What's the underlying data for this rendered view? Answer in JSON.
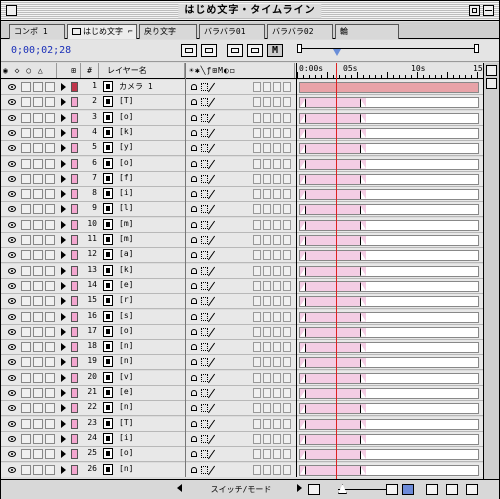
{
  "window": {
    "title": "はじめ文字・タイムライン"
  },
  "tabs": [
    {
      "label": "コンポ 1"
    },
    {
      "label": "はじめ文字 ⌐"
    },
    {
      "label": "戻り文字"
    },
    {
      "label": "バラバラ01"
    },
    {
      "label": "バラバラ02"
    },
    {
      "label": "輪"
    }
  ],
  "toolbar": {
    "timecode": "0;00;02;28",
    "m_label": "M"
  },
  "columns": {
    "switches_icons": "☀✱╲ƒ⊞M◐◻",
    "layer_name": "レイヤー名",
    "num": "#",
    "av": "◉ ◇ ○ △"
  },
  "timeline": {
    "tick_labels": [
      "0:00s",
      "05s",
      "10s",
      "15"
    ]
  },
  "layers": [
    {
      "num": "1",
      "name": "カメラ 1",
      "label_color": "#c0354b",
      "camera": true
    },
    {
      "num": "2",
      "name": "[T]",
      "label_color": "#f3a6cf"
    },
    {
      "num": "3",
      "name": "[o]",
      "label_color": "#f3a6cf"
    },
    {
      "num": "4",
      "name": "[k]",
      "label_color": "#f3a6cf"
    },
    {
      "num": "5",
      "name": "[y]",
      "label_color": "#f3a6cf"
    },
    {
      "num": "6",
      "name": "[o]",
      "label_color": "#f3a6cf"
    },
    {
      "num": "7",
      "name": "[f]",
      "label_color": "#f3a6cf"
    },
    {
      "num": "8",
      "name": "[i]",
      "label_color": "#f3a6cf"
    },
    {
      "num": "9",
      "name": "[l]",
      "label_color": "#f3a6cf"
    },
    {
      "num": "10",
      "name": "[m]",
      "label_color": "#f3a6cf"
    },
    {
      "num": "11",
      "name": "[m]",
      "label_color": "#f3a6cf"
    },
    {
      "num": "12",
      "name": "[a]",
      "label_color": "#f3a6cf"
    },
    {
      "num": "13",
      "name": "[k]",
      "label_color": "#f3a6cf"
    },
    {
      "num": "14",
      "name": "[e]",
      "label_color": "#f3a6cf"
    },
    {
      "num": "15",
      "name": "[r]",
      "label_color": "#f3a6cf"
    },
    {
      "num": "16",
      "name": "[s]",
      "label_color": "#f3a6cf"
    },
    {
      "num": "17",
      "name": "[o]",
      "label_color": "#f3a6cf"
    },
    {
      "num": "18",
      "name": "[n]",
      "label_color": "#f3a6cf"
    },
    {
      "num": "19",
      "name": "[n]",
      "label_color": "#f3a6cf"
    },
    {
      "num": "20",
      "name": "[v]",
      "label_color": "#f3a6cf"
    },
    {
      "num": "21",
      "name": "[e]",
      "label_color": "#f3a6cf"
    },
    {
      "num": "22",
      "name": "[n]",
      "label_color": "#f3a6cf"
    },
    {
      "num": "23",
      "name": "[T]",
      "label_color": "#f3a6cf"
    },
    {
      "num": "24",
      "name": "[i]",
      "label_color": "#f3a6cf"
    },
    {
      "num": "25",
      "name": "[o]",
      "label_color": "#f3a6cf"
    },
    {
      "num": "26",
      "name": "[n]",
      "label_color": "#f3a6cf"
    }
  ],
  "bottom": {
    "mode_label": "スイッチ/モード"
  },
  "colors": {
    "playhead": "#dd2222",
    "bar_fill": "#f4cde4",
    "camera_bar": "#e8a3a8",
    "timecode": "#1a2fb8"
  }
}
